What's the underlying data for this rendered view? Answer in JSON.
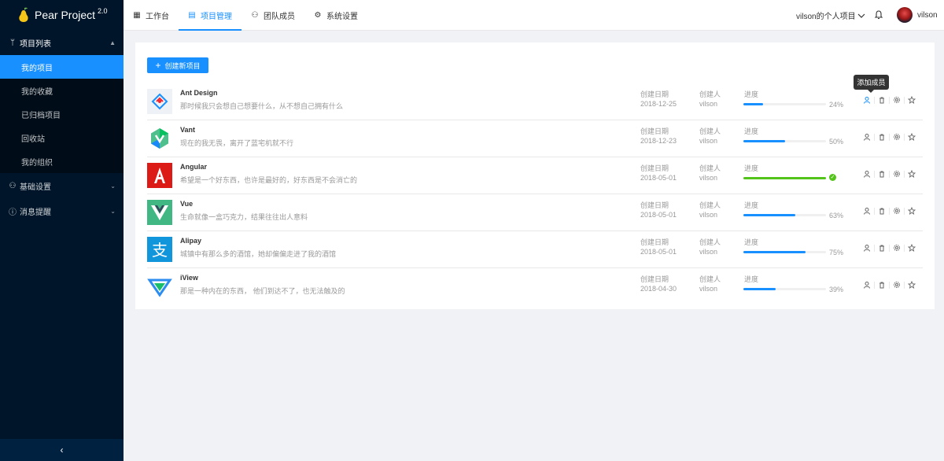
{
  "app": {
    "name": "Pear Project",
    "version": "2.0"
  },
  "sidebar": {
    "groups": [
      {
        "label": "项目列表",
        "icon": "branch-icon",
        "expanded": true,
        "items": [
          {
            "label": "我的项目",
            "active": true
          },
          {
            "label": "我的收藏",
            "active": false
          },
          {
            "label": "已归档项目",
            "active": false
          },
          {
            "label": "回收站",
            "active": false
          },
          {
            "label": "我的组织",
            "active": false
          }
        ]
      },
      {
        "label": "基础设置",
        "icon": "team-icon",
        "expanded": false
      },
      {
        "label": "消息提醒",
        "icon": "info-circle-icon",
        "expanded": false
      }
    ],
    "collapse_glyph": "‹"
  },
  "header": {
    "nav": [
      {
        "label": "工作台",
        "icon": "dashboard-icon",
        "active": false
      },
      {
        "label": "项目管理",
        "icon": "project-icon",
        "active": true
      },
      {
        "label": "团队成员",
        "icon": "team-icon",
        "active": false
      },
      {
        "label": "系统设置",
        "icon": "gear-icon",
        "active": false
      }
    ],
    "org_name": "vilson的个人项目",
    "username": "vilson"
  },
  "content": {
    "create_label": "创建新项目",
    "tooltip": "添加成员",
    "labels": {
      "created_date": "创建日期",
      "creator": "创建人",
      "progress": "进度"
    },
    "projects": [
      {
        "name": "Ant Design",
        "desc": "那时候我只会想自己想要什么，从不想自己拥有什么",
        "date": "2018-12-25",
        "creator": "vilson",
        "progress": 24,
        "pct_text": "24%",
        "logo": "antd-logo"
      },
      {
        "name": "Vant",
        "desc": "现在的我无畏，离开了蓝宅机就不行",
        "date": "2018-12-23",
        "creator": "vilson",
        "progress": 50,
        "pct_text": "50%",
        "logo": "vant-logo"
      },
      {
        "name": "Angular",
        "desc": "希望是一个好东西，也许是最好的，好东西是不会消亡的",
        "date": "2018-05-01",
        "creator": "vilson",
        "progress": 100,
        "pct_text": "",
        "logo": "angular-logo"
      },
      {
        "name": "Vue",
        "desc": "生命就像一盒巧克力，结果往往出人意料",
        "date": "2018-05-01",
        "creator": "vilson",
        "progress": 63,
        "pct_text": "63%",
        "logo": "vue-logo"
      },
      {
        "name": "Alipay",
        "desc": "城镇中有那么多的酒馆，她却偏偏走进了我的酒馆",
        "date": "2018-05-01",
        "creator": "vilson",
        "progress": 75,
        "pct_text": "75%",
        "logo": "alipay-logo"
      },
      {
        "name": "iView",
        "desc": "那是一种内在的东西， 他们到达不了，也无法触及的",
        "date": "2018-04-30",
        "creator": "vilson",
        "progress": 39,
        "pct_text": "39%",
        "logo": "iview-logo"
      }
    ]
  },
  "colors": {
    "primary": "#1890ff",
    "success": "#52c41a",
    "sidebar_bg": "#001529"
  }
}
